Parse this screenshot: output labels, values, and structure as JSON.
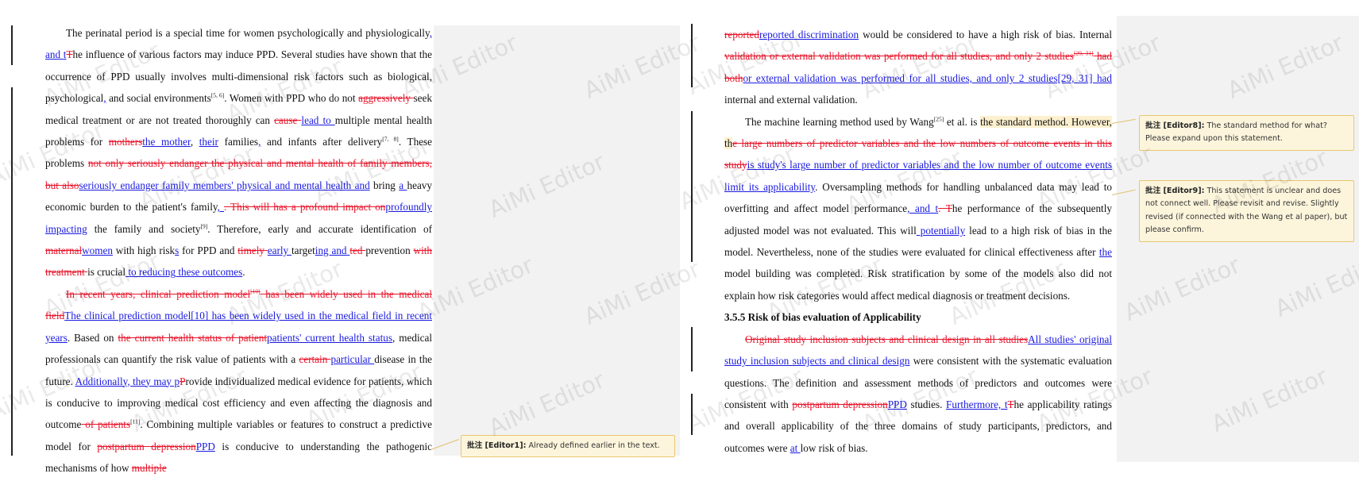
{
  "watermark": "AiMi Editor",
  "left": {
    "p1": {
      "a": "The perinatal period is a special time for women psychologically and physiologically",
      "b": ", and ",
      "c": "t",
      "d": "T",
      "e": "he influence of various factors may induce PPD. Several studies have shown that the occurrence of PPD usually involves multi-dimensional risk factors such as biological, psychological",
      "f": ",",
      "g": " and social environments",
      "h": "[5, 6]",
      "i": ". Women with PPD who do not ",
      "j": "aggressively ",
      "k": "seek medical treatment or are not treated thoroughly can ",
      "l": "cause ",
      "m": "lead to ",
      "n": "multiple mental health problems for ",
      "o": "mothers",
      "p": "the mother",
      "q": ", ",
      "r": "their",
      "s": " families",
      "t": ",",
      "u": " and infants after delivery",
      "v": "[7, 8]",
      "w": ". These problems ",
      "x": "not only seriously endanger the physical and mental health of family members, but also",
      "y": "seriously endanger family members' physical and mental health and",
      "z": " bring ",
      "a2": "a ",
      "b2": "heavy economic burden to the patient's family",
      "c2": ", ",
      "d2": ". This will has a profound impact on",
      "e2": "profoundly impacting",
      "f2": " the family and society",
      "g2": "[9]",
      "h2": ". Therefore, early and accurate identification of ",
      "i2": "maternal",
      "j2": "women",
      "k2": " with high risk",
      "l2": "s",
      "m2": " for PPD and ",
      "n2": "timely ",
      "o2": "early ",
      "p2": "target",
      "q2": "ing and ",
      "r2": "ted ",
      "s2": "prevention ",
      "t2": "with treatment ",
      "u2": "is crucial",
      "v2": " to reducing these outcomes",
      "w2": "."
    },
    "p2": {
      "a": "In recent years, clinical prediction model",
      "b": "[10]",
      "c": " has been widely used in the medical field",
      "d": "The clinical prediction model[10] has been widely used in the medical field in recent years",
      "e": ". Based on ",
      "f": "the current health status of patient",
      "g": "patients' current health status",
      "h": ", medical professionals can quantify the risk value of patients with a ",
      "i": "certain ",
      "j": "particular ",
      "k": "disease in the future. ",
      "l": "Additionally, they may p",
      "m": "P",
      "n": "rovide individualized medical evidence for patients, which is conducive to improving medical cost efficiency and even affecting the diagnosis and outcome",
      "o": " of patients",
      "p": "[11]",
      "q": ". Combining multiple variables or features to construct a predictive model for ",
      "r": "postpartum depression",
      "s": "PPD",
      "t": " is conducive to understanding the pathogenic mechanisms of how ",
      "u": "multiple"
    }
  },
  "right": {
    "p1": {
      "a": "reported",
      "b": "reported discrimination",
      "c": " would be considered to have a high risk of bias. Internal ",
      "d": "validation or external validation was performed for all studies, and only 2 studies",
      "e": "[29, 31]",
      "f": " had both",
      "g": "or external validation was performed for all studies, and only 2 studies[29, 31] had",
      "h": " internal and external validation."
    },
    "p2": {
      "a": "The machine learning method used by Wang",
      "b": "[25]",
      "c": " et al. is ",
      "d": "the standard method. However, th",
      "e": "e large numbers of predictor variables and the low numbers of outcome events in this study",
      "f": "is study's large number of predictor variables and the low number of outcome events limit its applicability",
      "g": ". Oversampling methods for handling unbalanced data may lead to overfitting and affect model performance",
      "h": ", and t",
      "i": ". T",
      "j": "he performance of the subsequently adjusted model was not evaluated. This will",
      "k": " potentially",
      "l": " lead to a high risk of bias in the model. Nevertheless, none of the studies were evaluated for clinical effectiveness after ",
      "m": "the ",
      "n": "model building was completed. Risk stratification by some of the models also did not explain how risk categories would affect medical diagnosis or treatment decisions."
    },
    "heading": "3.5.5 Risk of bias evaluation of Applicability",
    "p3": {
      "a": "Original study inclusion subjects and clinical design in all studies",
      "b": "All studies' original study inclusion subjects and clinical design",
      "c": " were consistent with the systematic evaluation questions. The definition and assessment methods of predictors and outcomes were consistent with ",
      "d": "postpartum depression",
      "e": "PPD",
      "f": " studies. ",
      "g": "Furthermore, t",
      "h": "T",
      "i": "he applicability ratings and overall applicability of the three domains of study participants, predictors, and outcomes were ",
      "j": "at ",
      "k": "low risk of bias."
    }
  },
  "comments": {
    "c1": {
      "author": "批注 [Editor1]:",
      "text": " Already defined earlier in the text."
    },
    "c8": {
      "author": "批注 [Editor8]:",
      "text": " The standard method for what? Please expand upon this statement."
    },
    "c9": {
      "author": "批注 [Editor9]:",
      "text": " This statement is unclear and does not connect well. Please revisit and revise. Slightly revised (if connected with the Wang et al paper), but please confirm."
    }
  }
}
